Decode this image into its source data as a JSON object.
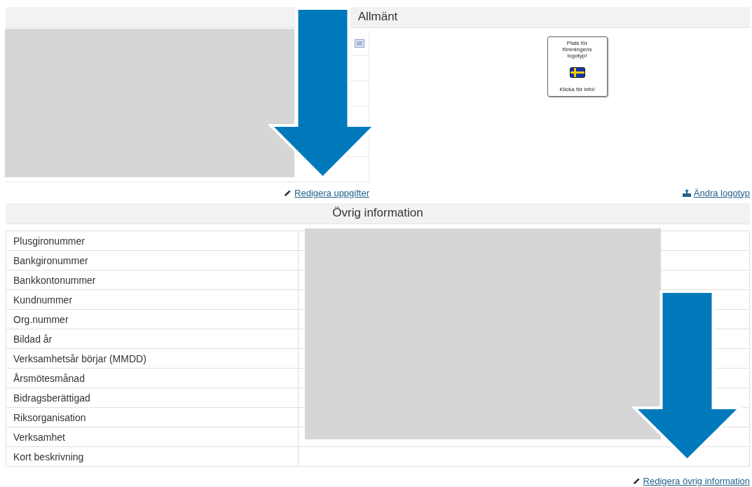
{
  "general": {
    "title": "Allmänt",
    "logo_box": {
      "caption": "Plats för föreningens logotyp!",
      "action": "Klicka för info!"
    },
    "edit_link": "Redigera uppgifter",
    "logo_link": "Ändra logotyp"
  },
  "other_info": {
    "title": "Övrig information",
    "rows": [
      {
        "label": "Plusgironummer"
      },
      {
        "label": "Bankgironummer"
      },
      {
        "label": "Bankkontonummer"
      },
      {
        "label": "Kundnummer"
      },
      {
        "label": "Org.nummer"
      },
      {
        "label": "Bildad år"
      },
      {
        "label": "Verksamhetsår börjar (MMDD)"
      },
      {
        "label": "Årsmötesmånad"
      },
      {
        "label": "Bidragsberättigad"
      },
      {
        "label": "Riksorganisation"
      },
      {
        "label": "Verksamhet"
      },
      {
        "label": "Kort beskrivning"
      }
    ],
    "edit_link": "Redigera övrig information"
  }
}
